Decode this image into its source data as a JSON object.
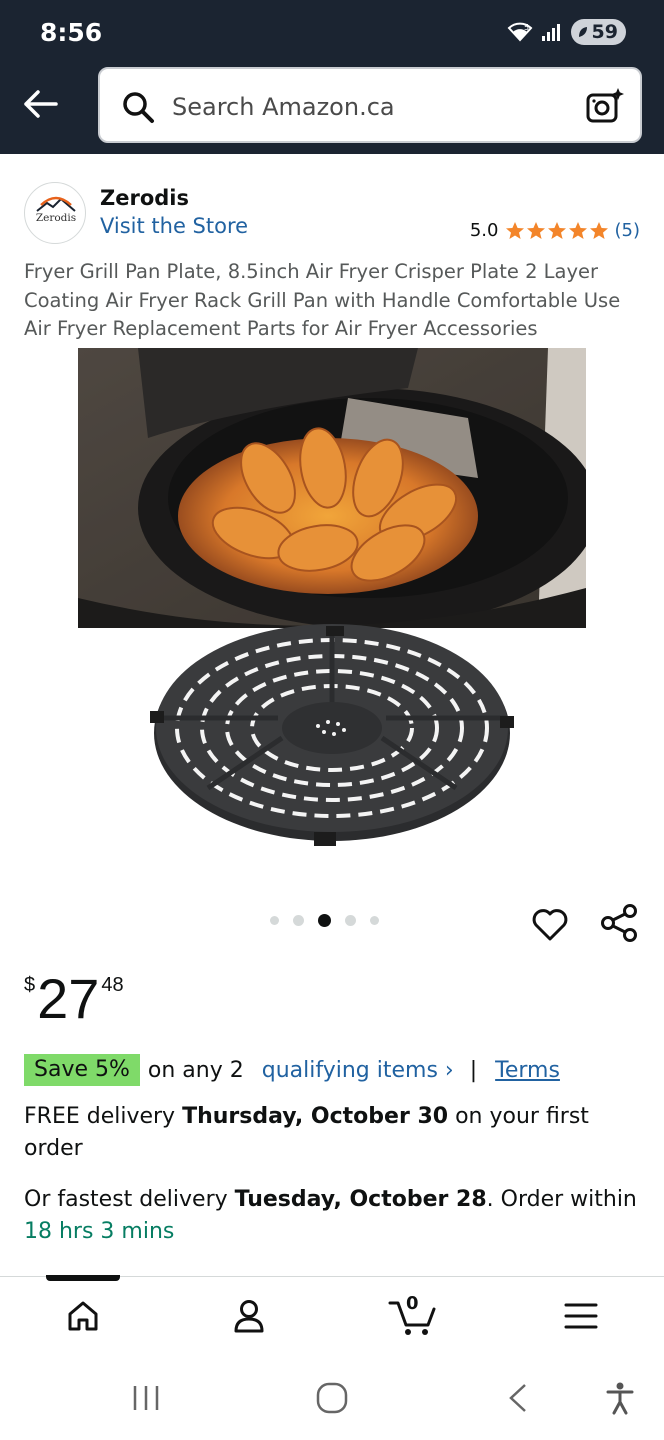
{
  "status_bar": {
    "time": "8:56",
    "battery": "59"
  },
  "search": {
    "placeholder": "Search Amazon.ca"
  },
  "brand": {
    "name": "Zerodis",
    "logo_text": "Zerodis",
    "visit_label": "Visit the Store"
  },
  "rating": {
    "value": "5.0",
    "stars": 5,
    "count": "(5)"
  },
  "product": {
    "title": "Fryer Grill Pan Plate, 8.5inch Air Fryer Crisper Plate 2 Layer Coating Air Fryer Rack Grill Pan with Handle Comfortable Use Air Fryer Replacement Parts for Air Fryer Accessories",
    "image_count": 5,
    "active_image": 3
  },
  "price": {
    "symbol": "$",
    "whole": "27",
    "fraction": "48"
  },
  "promo": {
    "badge": "Save 5%",
    "text": "on any 2",
    "link": "qualifying items ›",
    "separator": "|",
    "terms": "Terms"
  },
  "delivery": {
    "prefix": "FREE delivery ",
    "date": "Thursday, October 30",
    "suffix": " on your first order"
  },
  "fastest": {
    "prefix": "Or fastest delivery ",
    "date": "Tuesday, October 28",
    "middle": ". Order within ",
    "countdown": "18 hrs 3 mins"
  },
  "bottom_nav": {
    "cart_count": "0"
  },
  "colors": {
    "header": "#1b2431",
    "link": "#2162a1",
    "star": "#f3852a",
    "save_badge": "#7fda69",
    "countdown": "#067d62"
  }
}
